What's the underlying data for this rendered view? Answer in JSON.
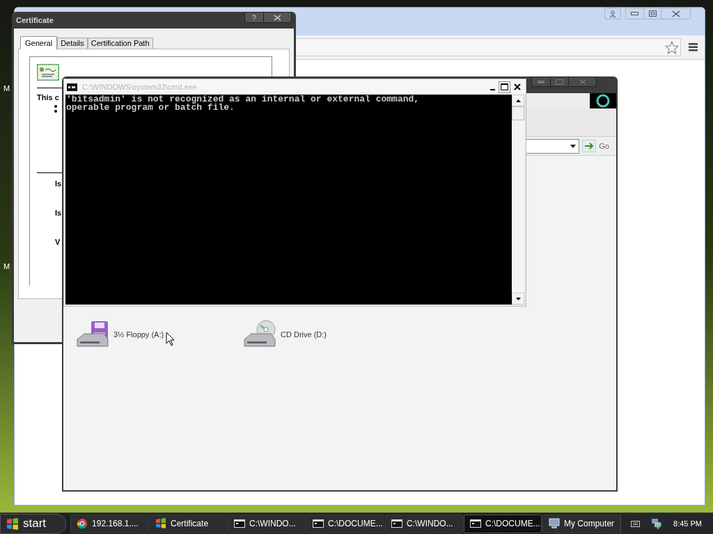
{
  "desktop_icons": [
    "M",
    "M"
  ],
  "certificate": {
    "title": "Certificate",
    "tabs": [
      {
        "label": "General",
        "selected": true
      },
      {
        "label": "Details",
        "selected": false
      },
      {
        "label": "Certification Path",
        "selected": false
      }
    ],
    "heading": "This c",
    "fields": [
      "Is",
      "Is",
      "V"
    ]
  },
  "explorer": {
    "go_button": "Go",
    "drives": [
      {
        "label": "3½ Floppy (A:)",
        "kind": "floppy"
      },
      {
        "label": "CD Drive (D:)",
        "kind": "cd"
      }
    ]
  },
  "cmd": {
    "title": "C:\\WINDOWS\\system32\\cmd.exe",
    "lines": [
      "'bitsadmin' is not recognized as an internal or external command,",
      "operable program or batch file."
    ]
  },
  "taskbar": {
    "start": "start",
    "items": [
      {
        "label": "192.168.1....",
        "kind": "browser",
        "selected": false
      },
      {
        "label": "Certificate",
        "kind": "windows",
        "selected": false
      },
      {
        "label": "C:\\WINDO...",
        "kind": "console",
        "selected": false
      },
      {
        "label": "C:\\DOCUME...",
        "kind": "console",
        "selected": false
      },
      {
        "label": "C:\\WINDO...",
        "kind": "console",
        "selected": false
      },
      {
        "label": "C:\\DOCUME...",
        "kind": "console",
        "selected": true
      },
      {
        "label": "My Computer",
        "kind": "computer",
        "selected": false
      }
    ],
    "clock": "8:45 PM"
  }
}
